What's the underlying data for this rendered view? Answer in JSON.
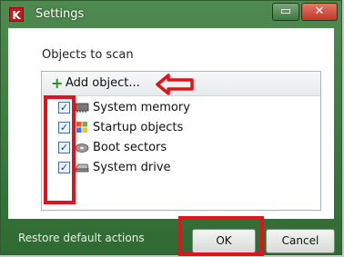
{
  "window": {
    "title": "Settings",
    "app_icon_letter": "K",
    "minimize_glyph": "▭",
    "close_glyph": "✕"
  },
  "scan": {
    "section_title": "Objects to scan",
    "add_button_label": "Add object...",
    "items": [
      {
        "label": "System memory",
        "icon": "memory-chip-icon",
        "checked": true
      },
      {
        "label": "Startup objects",
        "icon": "windows-logo-icon",
        "checked": true
      },
      {
        "label": "Boot sectors",
        "icon": "disk-icon",
        "checked": true
      },
      {
        "label": "System drive",
        "icon": "drive-icon",
        "checked": true
      }
    ]
  },
  "footer": {
    "restore_label": "Restore default actions",
    "ok_label": "OK",
    "cancel_label": "Cancel"
  },
  "colors": {
    "frame": "#3f7a42",
    "highlight": "#e0131b",
    "add_icon": "#2c8c2c"
  }
}
